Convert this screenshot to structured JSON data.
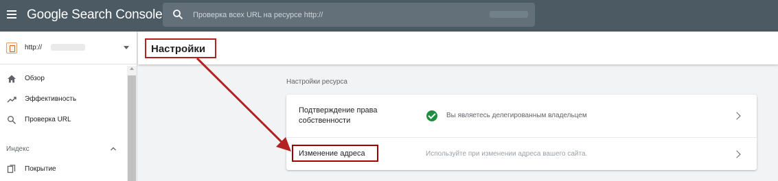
{
  "header": {
    "app_title": "Google Search Console",
    "search_placeholder": "Проверка всех URL на ресурсе http://",
    "menu_icon": "hamburger-menu-icon",
    "search_icon": "search-icon"
  },
  "sidebar": {
    "property_url": "http://",
    "items": [
      {
        "label": "Обзор",
        "icon": "home-icon"
      },
      {
        "label": "Эффективность",
        "icon": "trending-up-icon"
      },
      {
        "label": "Проверка URL",
        "icon": "search-icon"
      }
    ],
    "section": {
      "label": "Индекс",
      "icon": "chevron-up-icon"
    },
    "section_items": [
      {
        "label": "Покрытие",
        "icon": "copy-icon"
      }
    ]
  },
  "main": {
    "page_title": "Настройки",
    "section_title": "Настройки ресурса",
    "rows": [
      {
        "label": "Подтверждение права собственности",
        "status": "Вы являетесь делегированным владельцем",
        "status_icon": "check-circle-icon"
      },
      {
        "label": "Изменение адреса",
        "hint": "Используйте при изменении адреса вашего сайта."
      }
    ]
  },
  "colors": {
    "topbar": "#4b5a63",
    "annotation": "#b22222",
    "success": "#1e8e3e"
  }
}
